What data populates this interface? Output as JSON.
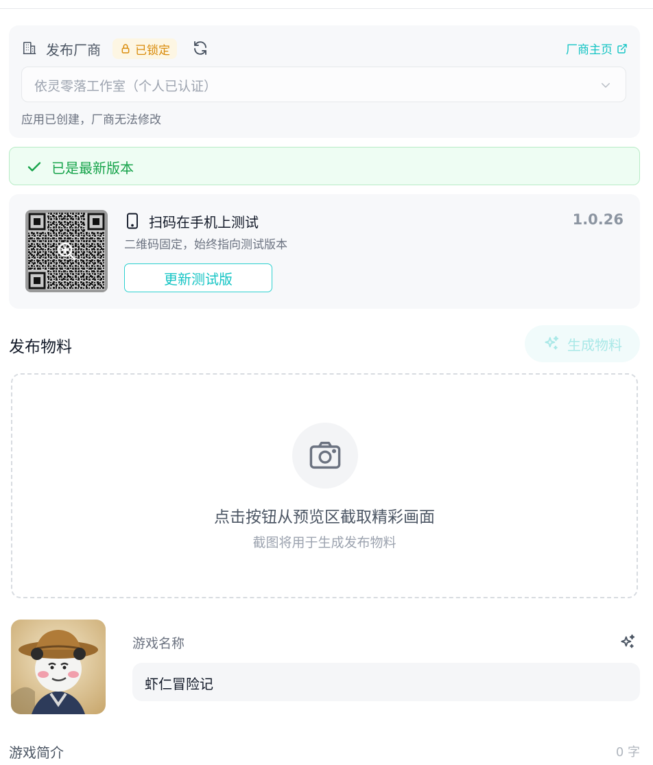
{
  "vendor": {
    "label": "发布厂商",
    "locked_badge": "已锁定",
    "home_link": "厂商主页",
    "selected": "依灵零落工作室（个人已认证）",
    "hint": "应用已创建，厂商无法修改"
  },
  "status": {
    "message": "已是最新版本"
  },
  "test": {
    "title": "扫码在手机上测试",
    "subtitle": "二维码固定，始终指向测试版本",
    "update_button": "更新测试版",
    "version": "1.0.26"
  },
  "materials": {
    "title": "发布物料",
    "generate_button": "生成物料",
    "drop_main": "点击按钮从预览区截取精彩画面",
    "drop_sub": "截图将用于生成发布物料"
  },
  "game": {
    "name_label": "游戏名称",
    "name_value": "虾仁冒险记",
    "intro_label": "游戏简介",
    "char_count": "0 字"
  },
  "colors": {
    "accent": "#14c4c4",
    "success": "#16a34a",
    "warning": "#d98b0a"
  }
}
